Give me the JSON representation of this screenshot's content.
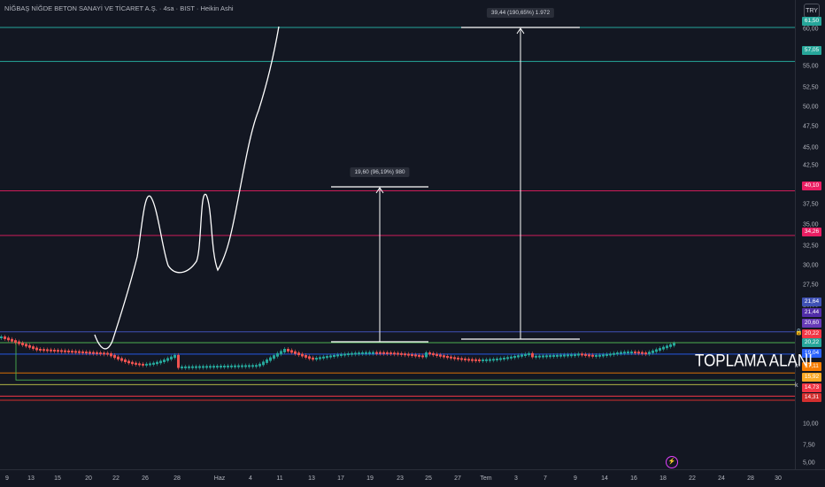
{
  "header": {
    "title": "NİĞBAŞ NİĞDE BETON SANAYİ VE TİCARET A.Ş. · 4sa · BIST · Heikin Ashi",
    "currency": "TRY"
  },
  "y_axis": {
    "ticks": [
      "60,00",
      "57,50",
      "55,00",
      "52,50",
      "50,00",
      "47,50",
      "45,00",
      "42,50",
      "40,00",
      "37,50",
      "35,00",
      "32,50",
      "30,00",
      "27,50",
      "25,00",
      "22,50",
      "10,00",
      "7,50",
      "5,00"
    ]
  },
  "x_axis": {
    "ticks": [
      "9",
      "13",
      "15",
      "20",
      "22",
      "26",
      "28",
      "Haz",
      "4",
      "11",
      "13",
      "17",
      "19",
      "23",
      "25",
      "27",
      "Tem",
      "3",
      "7",
      "9",
      "14",
      "16",
      "18",
      "22",
      "24",
      "28",
      "30"
    ]
  },
  "price_tags": [
    {
      "label": "61,50",
      "color": "#26a69a"
    },
    {
      "label": "57,05",
      "color": "#26a69a"
    },
    {
      "label": "40,10",
      "color": "#e91e63"
    },
    {
      "label": "34,26",
      "color": "#e91e63"
    },
    {
      "label": "21,64",
      "color": "#3f51b5"
    },
    {
      "label": "21,44",
      "color": "#512da8"
    },
    {
      "label": "20,60",
      "color": "#673ab7"
    },
    {
      "label": "20,22",
      "color": "#f23645"
    },
    {
      "label": "20,22",
      "color": "#26a69a"
    },
    {
      "label": "19,04",
      "color": "#2962ff"
    },
    {
      "label": "17,11",
      "color": "#f57c00"
    },
    {
      "label": "15,92",
      "color": "#f9a825"
    },
    {
      "label": "14,73",
      "color": "#f23645"
    },
    {
      "label": "14,31",
      "color": "#d32f2f"
    }
  ],
  "horizontal_lines": [
    {
      "price": 61.5,
      "color": "#26a69a"
    },
    {
      "price": 57.05,
      "color": "#26a69a"
    },
    {
      "price": 40.1,
      "color": "#e91e63"
    },
    {
      "price": 34.26,
      "color": "#e91e63"
    },
    {
      "price": 21.64,
      "color": "#3f51b5"
    },
    {
      "price": 20.22,
      "color": "#4caf50"
    },
    {
      "price": 19.04,
      "color": "#2962ff"
    },
    {
      "price": 17.11,
      "color": "#f57c00"
    },
    {
      "price": 15.92,
      "color": "#c6ca4a"
    },
    {
      "price": 14.73,
      "color": "#f23645"
    },
    {
      "price": 14.31,
      "color": "#d32f2f"
    }
  ],
  "measurements": [
    {
      "label": "19,60 (96,19%) 980"
    },
    {
      "label": "39,44 (190,65%) 1.972"
    }
  ],
  "annotation": {
    "label": "TOPLAMA ALANI"
  },
  "markers": {
    "k1": "k",
    "k2": "k",
    "lightning": "⚡"
  }
}
